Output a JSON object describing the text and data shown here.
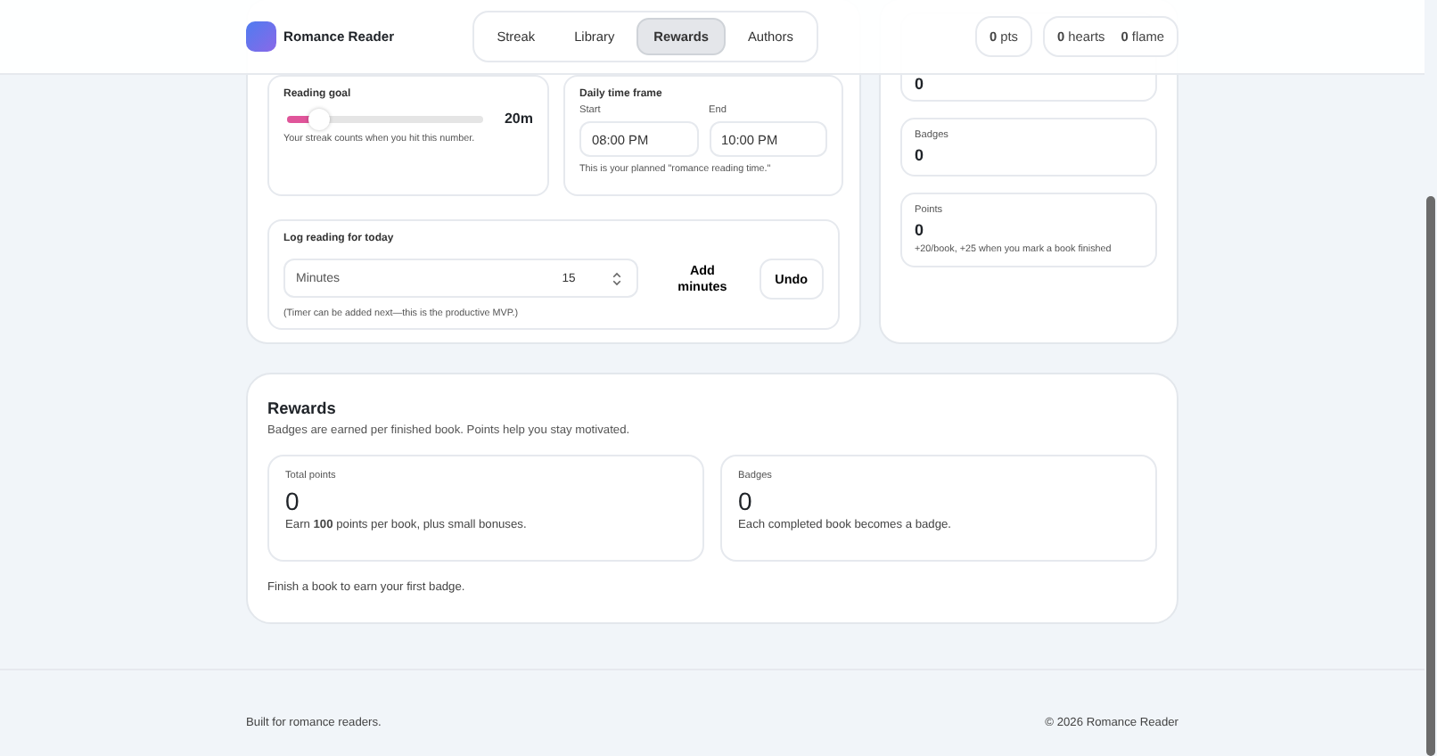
{
  "header": {
    "app_name": "Romance Reader",
    "tabs": [
      {
        "label": "Streak",
        "selected": false
      },
      {
        "label": "Library",
        "selected": false
      },
      {
        "label": "Rewards",
        "selected": true
      },
      {
        "label": "Authors",
        "selected": false
      }
    ],
    "stats": [
      {
        "items": [
          "**0** pts"
        ]
      },
      {
        "items": [
          "**0** hearts",
          "**0** flame"
        ]
      }
    ]
  },
  "streak": {
    "reading_goal": {
      "title": "Reading goal",
      "level": 0.16,
      "value": "20m",
      "note": "Your streak counts when you hit this number."
    },
    "time_frame": {
      "title": "Daily time frame",
      "start": {
        "label": "Start",
        "value": "08:00 PM"
      },
      "end": {
        "label": "End",
        "value": "10:00 PM"
      },
      "note": "This is your planned \"romance reading time.\""
    },
    "log": {
      "title": "Log reading for today",
      "field_label": "Minutes",
      "value": "15",
      "add_button": "Add minutes",
      "undo_button": "Undo",
      "note": "(Timer can be added next—this is the productive MVP.)"
    }
  },
  "summary": [
    {
      "value": "0"
    },
    {
      "label": "Badges",
      "value": "0"
    },
    {
      "label": "Points",
      "value": "0",
      "note": "+20/book, +25 when you mark a book finished"
    }
  ],
  "rewards": {
    "title": "Rewards",
    "description": "Badges are earned per finished book. Points help you stay motivated.",
    "cards": [
      {
        "label": "Total points",
        "value": "0",
        "note": "Earn **100** points per book, plus small bonuses."
      },
      {
        "label": "Badges",
        "value": "0",
        "note": "Each completed book becomes a badge."
      }
    ],
    "footnote": "Finish a book to earn your first badge."
  },
  "footer": {
    "left": "Built for romance readers.",
    "right": "© 2026 Romance Reader"
  }
}
